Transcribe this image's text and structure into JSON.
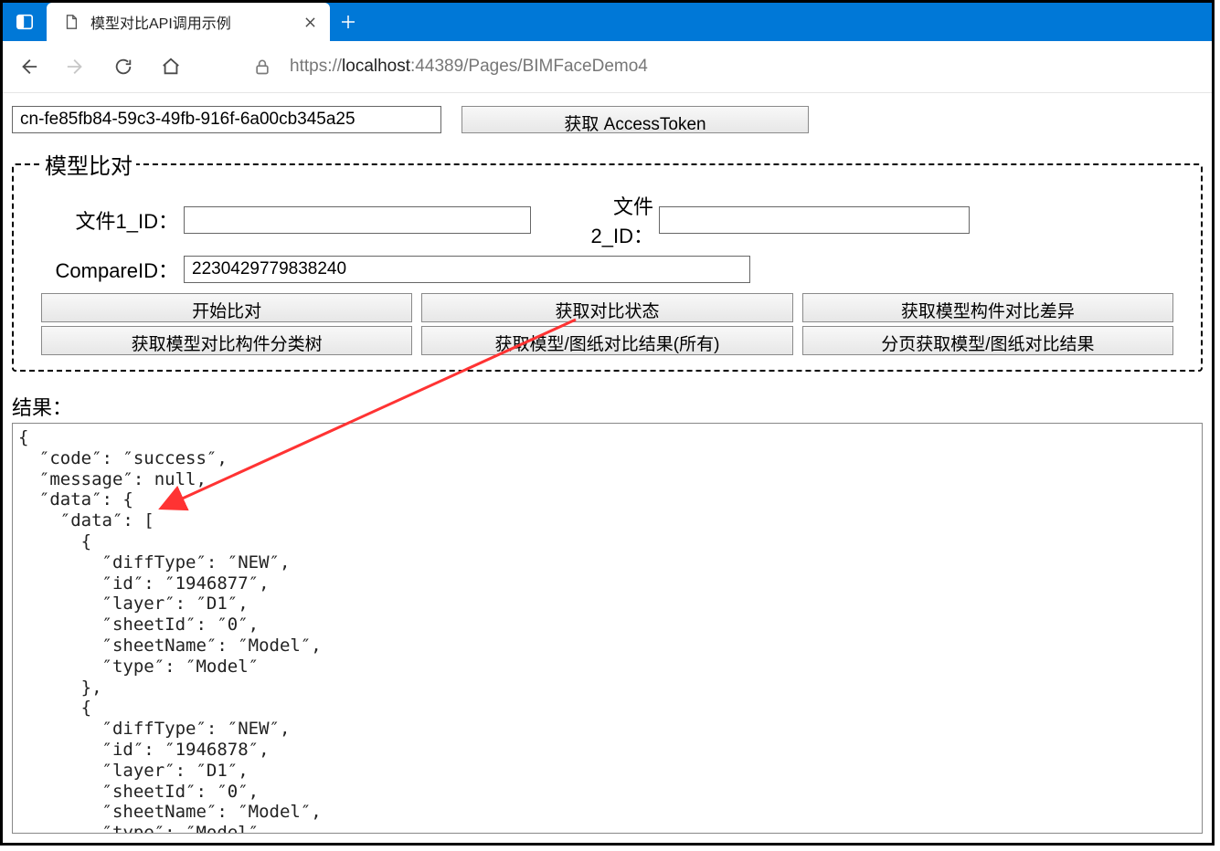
{
  "browser": {
    "tab_title": "模型对比API调用示例",
    "url_prefix": "https://",
    "url_host": "localhost",
    "url_path": ":44389/Pages/BIMFaceDemo4"
  },
  "top": {
    "app_key_value": "cn-fe85fb84-59c3-49fb-916f-6a00cb345a25",
    "get_token_label": "获取 AccessToken"
  },
  "compare": {
    "legend": "模型比对",
    "file1_label": "文件1_ID：",
    "file1_value": "",
    "file2_label": "文件2_ID：",
    "file2_value": "",
    "compare_id_label": "CompareID：",
    "compare_id_value": "2230429779838240",
    "buttons": [
      "开始比对",
      "获取对比状态",
      "获取模型构件对比差异",
      "获取模型对比构件分类树",
      "获取模型/图纸对比结果(所有)",
      "分页获取模型/图纸对比结果"
    ]
  },
  "result": {
    "label": "结果：",
    "text": "{\n  ″code″: ″success″,\n  ″message″: null,\n  ″data″: {\n    ″data″: [\n      {\n        ″diffType″: ″NEW″,\n        ″id″: ″1946877″,\n        ″layer″: ″D1″,\n        ″sheetId″: ″0″,\n        ″sheetName″: ″Model″,\n        ″type″: ″Model″\n      },\n      {\n        ″diffType″: ″NEW″,\n        ″id″: ″1946878″,\n        ″layer″: ″D1″,\n        ″sheetId″: ″0″,\n        ″sheetName″: ″Model″,\n        ″type″: ″Model″\n      }"
  }
}
